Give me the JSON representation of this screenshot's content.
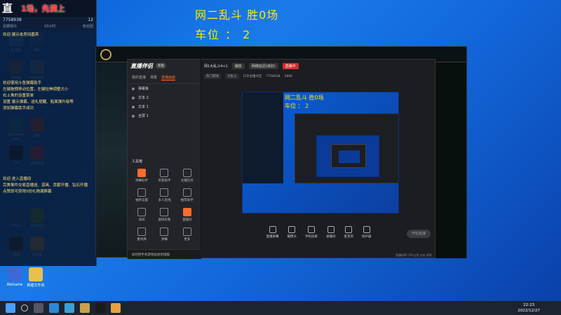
{
  "overlay": {
    "title": "网二乱斗 胜0场",
    "position": "车位 ： 2"
  },
  "chat": {
    "logo": "直",
    "banner": "1场，先满上",
    "viewer_count": "7758938",
    "likes": "12",
    "stat_left": "近期观众",
    "stat_mid": "10小时",
    "stat_right": "粉丝团",
    "messages": [
      "欢迎 展示本房间嘉宾",
      "欢迎使用斗鱼弹幕助手",
      "左键拖拽移动位置，左键拉伸调整大小",
      "右上角的设置菜单",
      "设置 展示弹幕、送礼提醒、贴面弹升级等",
      "添加弹幕助手成功",
      "欢迎 进入直播间",
      "完美事件交易直播送、道具、贡献开播、钻石开播",
      "点赞即可获得5份礼物满屏幕"
    ]
  },
  "desktop_icons": [
    {
      "label": "此电脑",
      "color": "#4aa0ff"
    },
    {
      "label": "网络",
      "color": "#3b7fd9"
    },
    {
      "label": "回收站",
      "color": "#777777"
    },
    {
      "label": "控制面板",
      "color": "#6a8ab8"
    },
    {
      "label": "Microsoft Edge",
      "color": "#2a8ad8"
    },
    {
      "label": "游戏",
      "color": "#d85a2a"
    },
    {
      "label": "QQ",
      "color": "#222222"
    },
    {
      "label": "直播伴侣",
      "color": "#e04848"
    },
    {
      "label": "Word",
      "color": "#2a5aa8"
    },
    {
      "label": "NVIDIA",
      "color": "#6aa828"
    },
    {
      "label": "直播",
      "color": "#333333"
    },
    {
      "label": "游戏盒",
      "color": "#d8a040"
    },
    {
      "label": "WeGame",
      "color": "#3a6ad8"
    },
    {
      "label": "新建文件夹",
      "color": "#e8c050"
    }
  ],
  "stream_app": {
    "brand": "直播伴侣",
    "version": "新版",
    "tabs": [
      "我的直播",
      "场景",
      "直播画面"
    ],
    "active_tab": "直播画面",
    "scenes": [
      "弹幕板",
      "文本 2",
      "文本 1",
      "全屏 1"
    ],
    "toolbox_title": "工具箱",
    "tools": [
      {
        "label": "弹幕助手",
        "orange": true
      },
      {
        "label": "房管助手",
        "orange": false
      },
      {
        "label": "主播任务",
        "orange": false
      },
      {
        "label": "抽奖设置",
        "orange": false
      },
      {
        "label": "多人连线",
        "orange": false
      },
      {
        "label": "推荐助手",
        "orange": false
      },
      {
        "label": "录屏",
        "orange": false
      },
      {
        "label": "虚拟形象",
        "orange": false
      },
      {
        "label": "直播间",
        "orange": true
      },
      {
        "label": "素材库",
        "orange": false
      },
      {
        "label": "弹幕",
        "orange": false
      },
      {
        "label": "更多",
        "orange": false
      }
    ],
    "tip": "如何把手机游戏投屏到电脑",
    "room_title": "网1大乱斗4+1",
    "status_pill": "播放",
    "network": "网络延迟(良好)",
    "live_badge": "直播中",
    "category_tag": "热门游戏",
    "room_info": "大乱斗",
    "fans_label": "口令主播大区",
    "viewer_id": "7758938",
    "like_count": "5806",
    "controls": [
      "直播屏幕",
      "摄像头",
      "手机投屏",
      "录播间",
      "麦克风",
      "扬声器"
    ],
    "start_button": "开始直播",
    "status_text": "直播码率 CPU占用 内存 帧率"
  },
  "taskbar": {
    "time": "22:23",
    "date": "2022/12/27"
  }
}
